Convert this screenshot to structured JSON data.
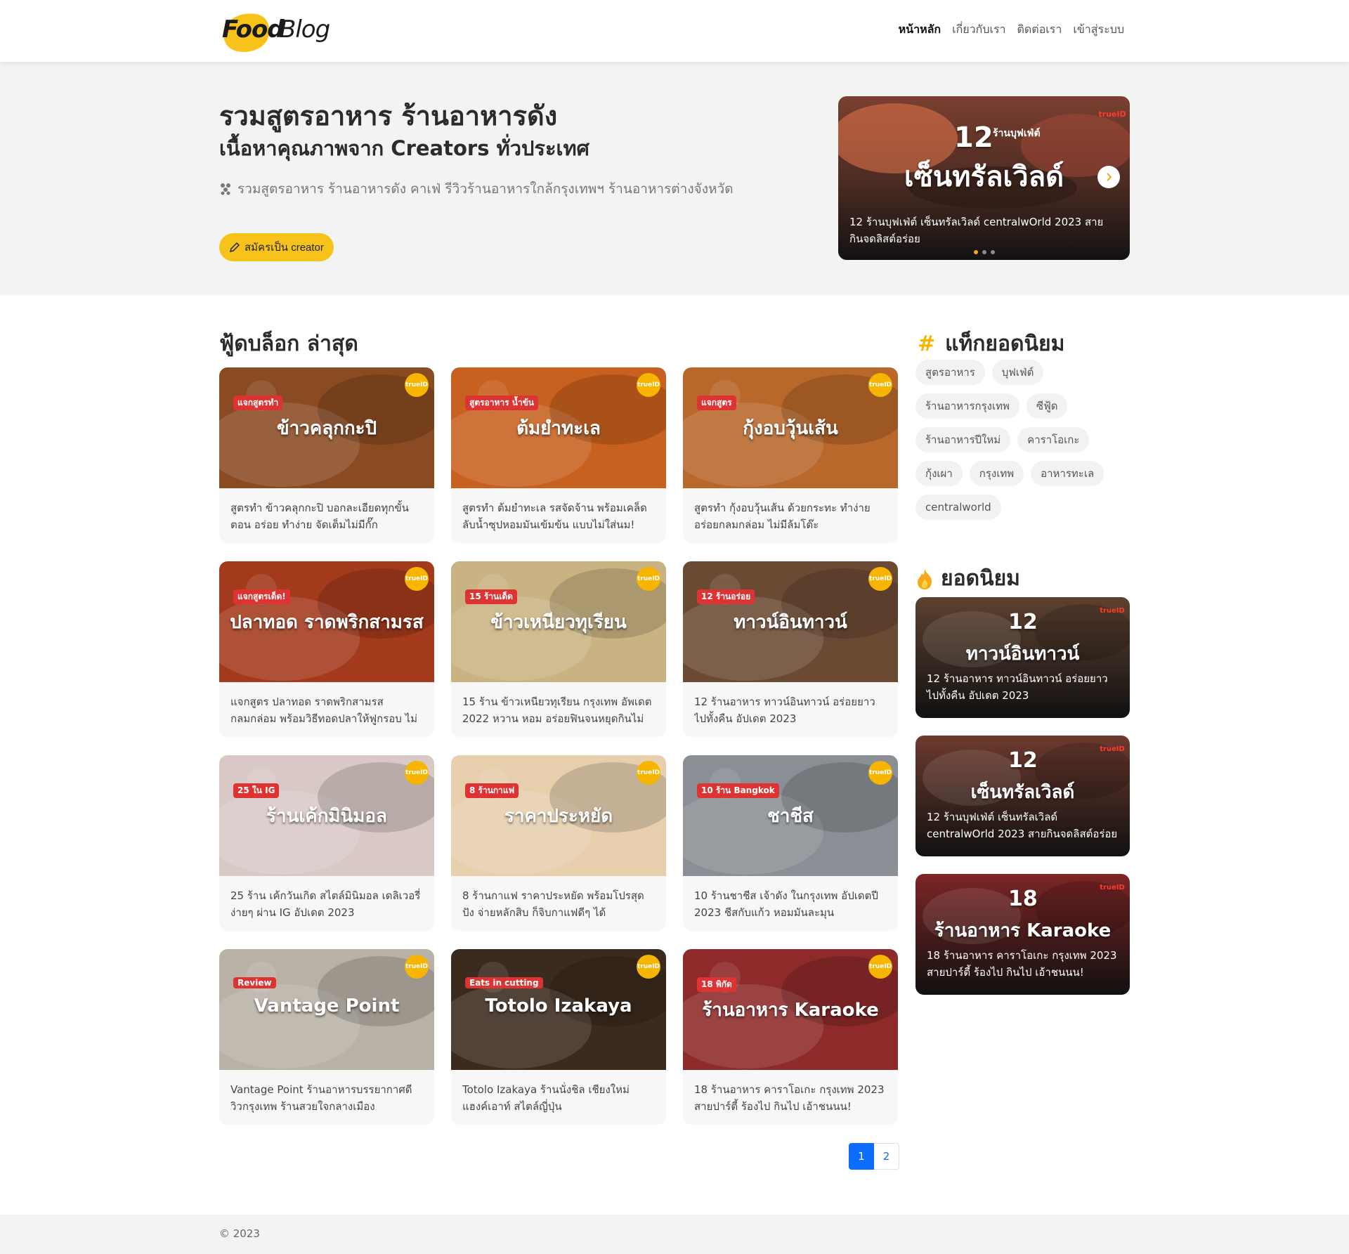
{
  "brand": {
    "word1": "Food",
    "word2": "Blog",
    "accent": "#f7c21a"
  },
  "nav": {
    "home": "หน้าหลัก",
    "about": "เกี่ยวกับเรา",
    "contact": "ติดต่อเรา",
    "login": "เข้าสู่ระบบ"
  },
  "hero": {
    "title": "รวมสูตรอาหาร ร้านอาหารดัง",
    "subtitle": "เนื้อหาคุณภาพจาก Creators ทั่วประเทศ",
    "description": "รวมสูตรอาหาร ร้านอาหารดัง คาเฟ่ รีวิวร้านอาหารใกล้กรุงเทพฯ ร้านอาหารต่างจังหวัด",
    "cta": "สมัครเป็น creator",
    "slide": {
      "num": "12",
      "small": "ร้านบุฟเฟ่ต์",
      "overlay": "เซ็นทรัลเวิลด์",
      "caption": "12 ร้านบุฟเฟ่ต์ เซ็นทรัลเวิลด์ centralwOrld 2023 สายกินจดลิสต์อร่อย",
      "dots": 3
    }
  },
  "latest": {
    "title": "ฟู้ดบล็อก ล่าสุด",
    "cards": [
      {
        "overlay": "ข้าวคลุกกะปิ",
        "kicker": "แจกสูตรทำ",
        "caption": "สูตรทำ ข้าวคลุกกะปิ บอกละเอียดทุกขั้นตอน อร่อย ทำง่าย จัดเต็มไม่มีกั๊ก",
        "color": "#8a4a22"
      },
      {
        "overlay": "ต้มยำทะเล",
        "kicker": "สูตรอาหาร น้ำข้น",
        "caption": "สูตรทำ ต้มยำทะเล รสจัดจ้าน พร้อมเคล็ดลับน้ำซุปหอมมันเข้มข้น แบบไม่ใส่นม!",
        "color": "#c8601f"
      },
      {
        "overlay": "กุ้งอบวุ้นเส้น",
        "kicker": "แจกสูตร",
        "caption": "สูตรทำ กุ้งอบวุ้นเส้น ด้วยกระทะ ทำง่าย อร่อยกลมกล่อม ไม่มีล้มโต๊ะ",
        "color": "#b9672a"
      },
      {
        "overlay": "ปลาทอด ราดพริกสามรส",
        "kicker": "แจกสูตรเด็ด!",
        "caption": "แจกสูตร ปลาทอด ราดพริกสามรส กลมกล่อม พร้อมวิธีทอดปลาให้ฟูกรอบ ไม่ติดกระทะ",
        "color": "#a33a1c"
      },
      {
        "overlay": "ข้าวเหนียวทุเรียน",
        "kicker": "15 ร้านเด็ด",
        "caption": "15 ร้าน ข้าวเหนียวทุเรียน กรุงเทพ อัพเดต 2022 หวาน หอม อร่อยฟินจนหยุดกินไม่ได้",
        "color": "#c9b382"
      },
      {
        "overlay": "ทาวน์อินทาวน์",
        "kicker": "12 ร้านอร่อย",
        "caption": "12 ร้านอาหาร ทาวน์อินทาวน์ อร่อยยาวไปทั้งคืน อัปเดต 2023",
        "color": "#6b4a34"
      },
      {
        "overlay": "ร้านเค้กมินิมอล",
        "kicker": "25 ใน IG",
        "caption": "25 ร้าน เค้กวันเกิด สไตล์มินิมอล เดลิเวอรี่ง่ายๆ ผ่าน IG อัปเดต 2023",
        "color": "#d9c9c6"
      },
      {
        "overlay": "ราคาประหยัด",
        "kicker": "8 ร้านกาแฟ",
        "caption": "8 ร้านกาแฟ ราคาประหยัด พร้อมโปรสุดปัง จ่ายหลักสิบ ก็จิบกาแฟดีๆ ได้",
        "color": "#e7cfae"
      },
      {
        "overlay": "ชาชีส",
        "kicker": "10 ร้าน Bangkok",
        "caption": "10 ร้านชาชีส เจ้าดัง ในกรุงเทพ อัปเดตปี 2023 ชีสกับแก้ว หอมมันละมุน",
        "color": "#8a8f95"
      },
      {
        "overlay": "Vantage Point",
        "kicker": "Review",
        "caption": "Vantage Point ร้านอาหารบรรยากาศดี วิวกรุงเทพ ร้านสวยใจกลางเมือง",
        "color": "#b8b1a6"
      },
      {
        "overlay": "Totolo Izakaya",
        "kicker": "Eats in cutting",
        "caption": "Totolo Izakaya ร้านนั่งชิล เชียงใหม่ แฮงค์เอาท์ สไตล์ญี่ปุ่น",
        "color": "#3b2a1e"
      },
      {
        "overlay": "ร้านอาหาร Karaoke",
        "kicker": "18 พิกัด",
        "caption": "18 ร้านอาหาร คาราโอเกะ กรุงเทพ 2023 สายปาร์ตี้ ร้องไป กินไป เอ้าชนนน!",
        "color": "#8e2a2a"
      }
    ]
  },
  "sidebar": {
    "tags_title": "แท็กยอดนิยม",
    "tags_icon": "#",
    "tags": [
      "สูตรอาหาร",
      "บุฟเฟ่ต์",
      "ร้านอาหารกรุงเทพ",
      "ซีฟู้ด",
      "ร้านอาหารปีใหม่",
      "คาราโอเกะ",
      "กุ้งเผา",
      "กรุงเทพ",
      "อาหารทะเล",
      "centralworld"
    ],
    "popular_title": "ยอดนิยม",
    "popular": [
      {
        "overlay": "ทาวน์อินทาวน์",
        "num": "12",
        "caption": "12 ร้านอาหาร ทาวน์อินทาวน์ อร่อยยาวไปทั้งคืน อัปเดต 2023",
        "color": "#5d4130"
      },
      {
        "overlay": "เซ็นทรัลเวิลด์",
        "num": "12",
        "caption": "12 ร้านบุฟเฟ่ต์ เซ็นทรัลเวิลด์ centralwOrld 2023 สายกินจดลิสต์อร่อย",
        "color": "#6d3a2e"
      },
      {
        "overlay": "ร้านอาหาร Karaoke",
        "num": "18",
        "caption": "18 ร้านอาหาร คาราโอเกะ กรุงเทพ 2023 สายปาร์ตี้ ร้องไป กินไป เอ้าชนนน!",
        "color": "#7d2525"
      }
    ]
  },
  "badge": "trueID",
  "pagination": {
    "current": "1",
    "next": "2"
  },
  "footer": {
    "copyright": "© 2023"
  }
}
